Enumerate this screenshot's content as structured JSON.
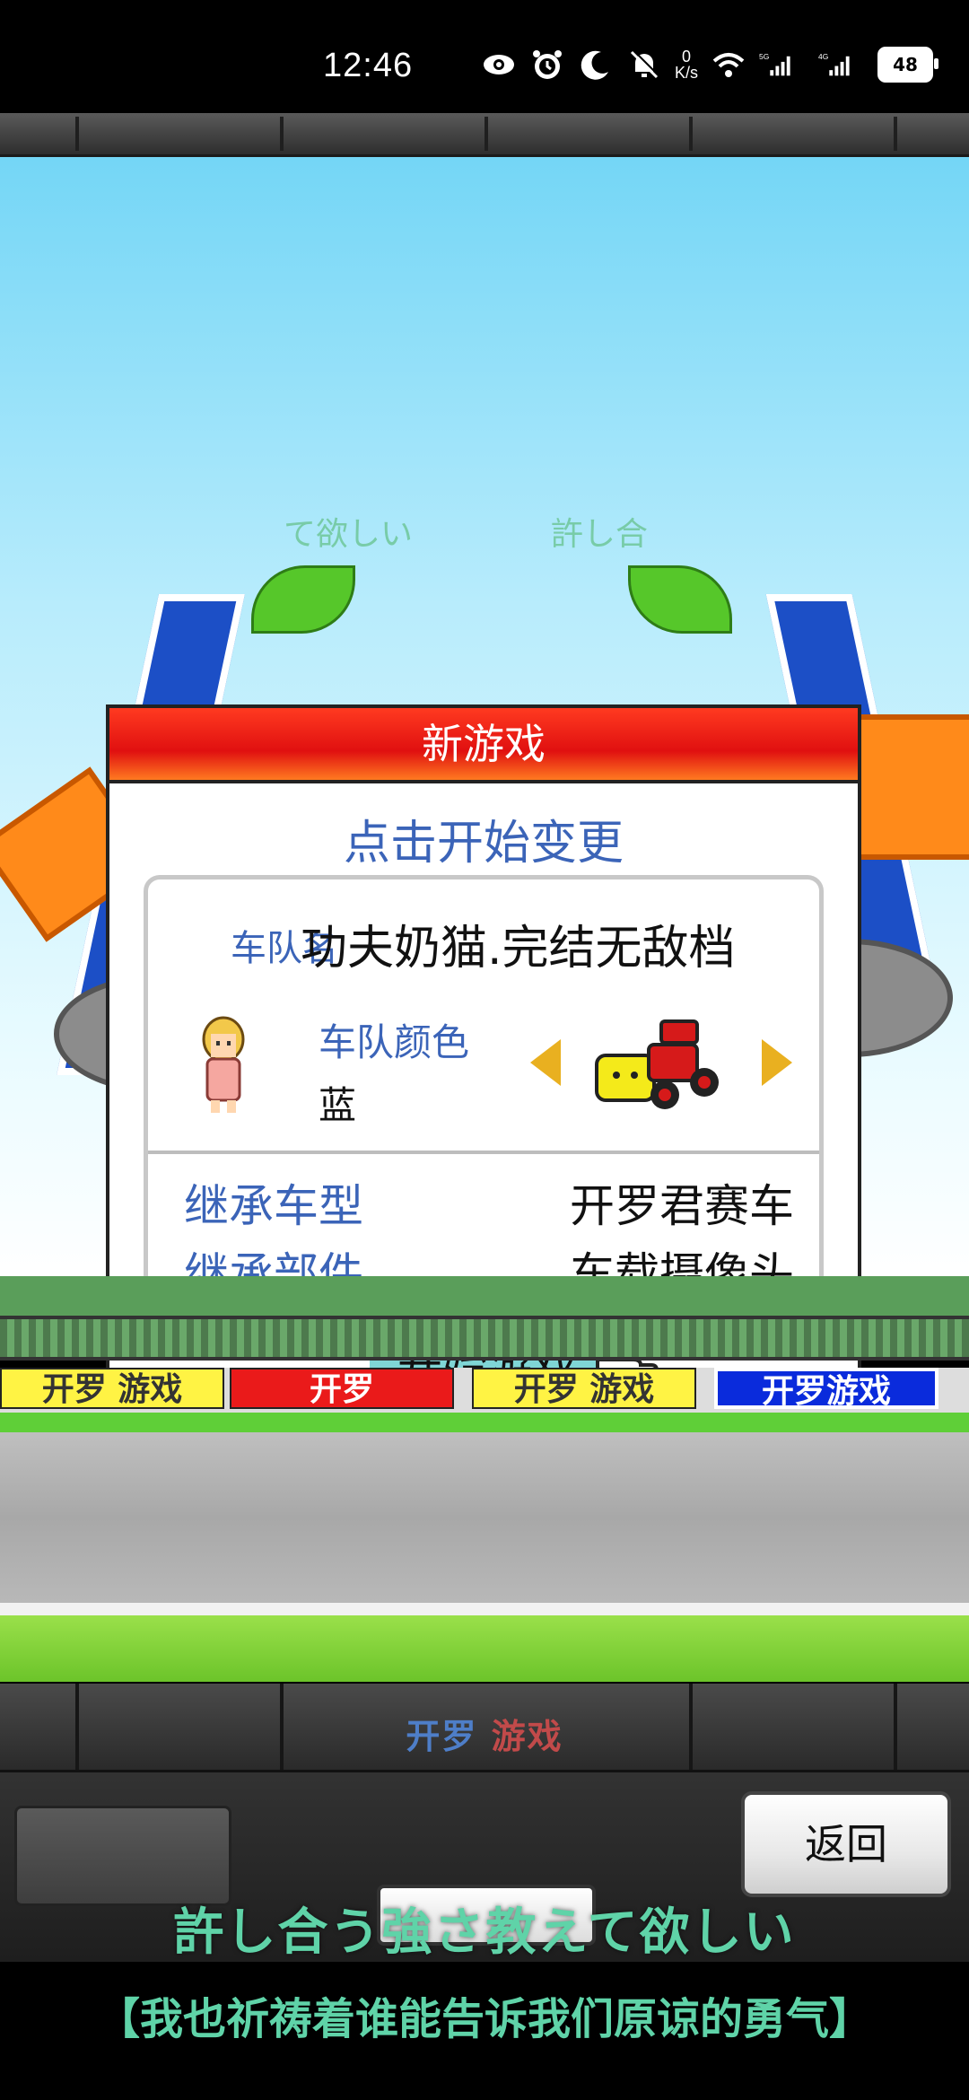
{
  "status_bar": {
    "time": "12:46",
    "net_speed_value": "0",
    "net_speed_unit": "K/s",
    "signal_5g": "5G",
    "signal_4g": "4G",
    "battery": "48",
    "icons": [
      "eye-icon",
      "alarm-icon",
      "moon-icon",
      "bell-off-icon",
      "wifi-icon",
      "signal-icon"
    ]
  },
  "background": {
    "lyric_left": "て欲しい",
    "lyric_right": "許し合"
  },
  "dialog": {
    "title": "新游戏",
    "hint": "点击开始变更",
    "team_label": "车队名",
    "team_name": "功夫奶猫.完结无敌档",
    "color_label": "车队颜色",
    "color_value": "蓝",
    "inherit_model_label": "继承车型",
    "inherit_model_value": "开罗君赛车",
    "inherit_parts_label": "继承部件",
    "inherit_parts_value": "车载摄像头",
    "start_button": "开始游戏"
  },
  "track": {
    "ads": [
      "开罗 游戏",
      "开罗",
      "开罗 游戏",
      "开罗游戏"
    ]
  },
  "bottom": {
    "brand_part1": "开罗",
    "brand_part2": "游戏",
    "back_button": "返回"
  },
  "subtitles": {
    "japanese": "許し合う強さ教えて欲しい",
    "chinese": "【我也祈祷着谁能告诉我们原谅的勇气】"
  },
  "colors": {
    "title_red": "#e01010",
    "label_blue": "#3b64b8",
    "start_button_bg": "#7fd6d6",
    "subtitle_green": "#5fd3a8"
  }
}
